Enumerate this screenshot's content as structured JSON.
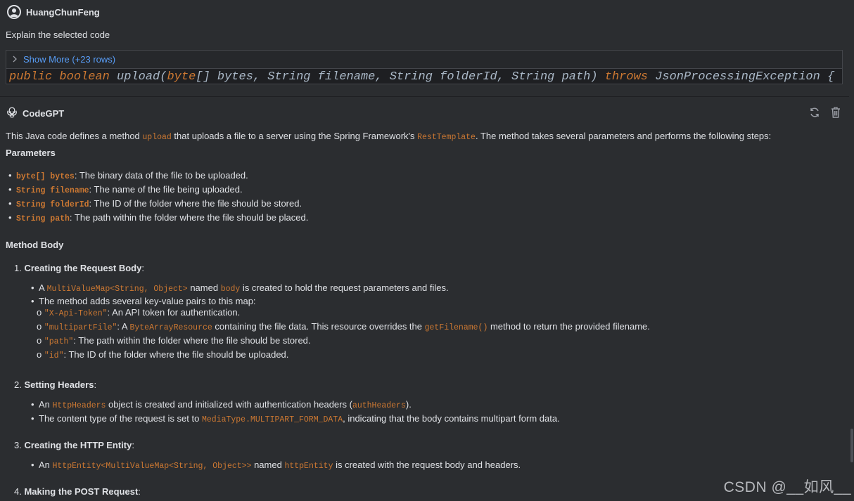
{
  "user": {
    "name": "HuangChunFeng",
    "prompt": "Explain the selected code",
    "show_more": "Show More (+23 rows)",
    "code": {
      "kw1": "public",
      "kw2": "boolean",
      "sig1": " upload(",
      "kw3": "byte",
      "sig2": "[] bytes, String filename, String folderId, String path) ",
      "kw4": "throws",
      "sig3": " JsonProcessingException {"
    }
  },
  "assistant": {
    "name": "CodeGPT",
    "intro": {
      "a": "This Java code defines a method ",
      "code1": "upload",
      "b": " that uploads a file to a server using the Spring Framework's ",
      "code2": "RestTemplate",
      "c": ". The method takes several parameters and performs the following steps:"
    },
    "params_heading": "Parameters",
    "params": [
      {
        "code": "byte[] bytes",
        "text": ": The binary data of the file to be uploaded."
      },
      {
        "code": "String filename",
        "text": ": The name of the file being uploaded."
      },
      {
        "code": "String folderId",
        "text": ": The ID of the folder where the file should be stored."
      },
      {
        "code": "String path",
        "text": ": The path within the folder where the file should be placed."
      }
    ],
    "method_heading": "Method Body",
    "steps": {
      "s1": {
        "num": "1.",
        "title": "Creating the Request Body",
        "b1": {
          "a": "A ",
          "code1": "MultiValueMap<String, Object>",
          "b": " named ",
          "code2": "body",
          "c": " is created to hold the request parameters and files."
        },
        "b2": "The method adds several key-value pairs to this map:",
        "sub1": {
          "code": "\"X-Api-Token\"",
          "text": ": An API token for authentication."
        },
        "sub2": {
          "code": "\"multipartFile\"",
          "a": ": A ",
          "code2": "ByteArrayResource",
          "b": " containing the file data. This resource overrides the ",
          "code3": "getFilename()",
          "c": " method to return the provided filename."
        },
        "sub3": {
          "code": "\"path\"",
          "text": ": The path within the folder where the file should be stored."
        },
        "sub4": {
          "code": "\"id\"",
          "text": ": The ID of the folder where the file should be uploaded."
        }
      },
      "s2": {
        "num": "2.",
        "title": "Setting Headers",
        "b1": {
          "a": "An ",
          "code1": "HttpHeaders",
          "b": " object is created and initialized with authentication headers (",
          "code2": "authHeaders",
          "c": ")."
        },
        "b2": {
          "a": "The content type of the request is set to ",
          "code1": "MediaType.MULTIPART_FORM_DATA",
          "b": ", indicating that the body contains multipart form data."
        }
      },
      "s3": {
        "num": "3.",
        "title": "Creating the HTTP Entity",
        "b1": {
          "a": "An ",
          "code1": "HttpEntity<MultiValueMap<String, Object>>",
          "b": " named ",
          "code2": "httpEntity",
          "c": " is created with the request body and headers."
        }
      },
      "s4": {
        "num": "4.",
        "title": "Making the POST Request"
      }
    }
  },
  "colon": ":",
  "bullet": "•",
  "circle": "o",
  "watermark": "CSDN @__如风__"
}
